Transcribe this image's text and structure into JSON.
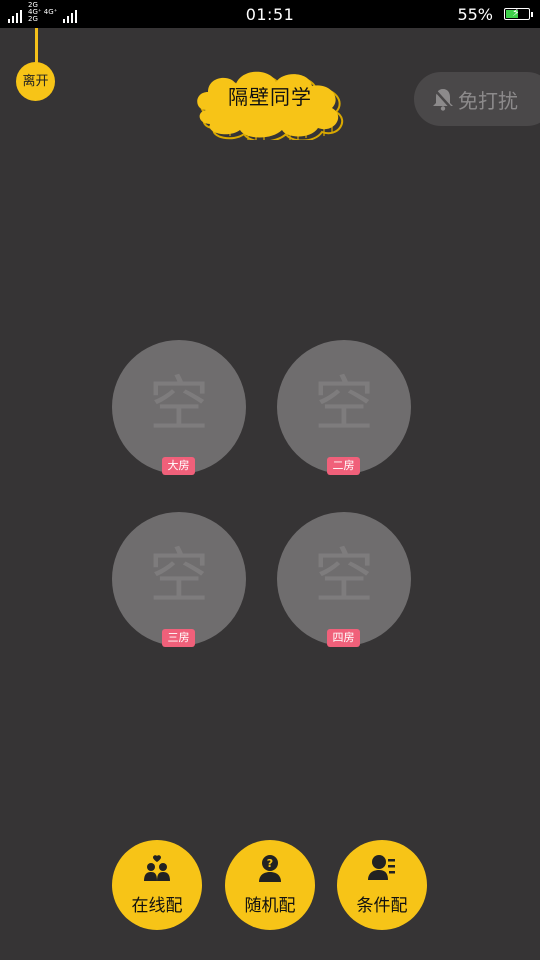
{
  "status_bar": {
    "net_top": "2G",
    "net_mid": "4G⁺ 4G⁺",
    "net_bottom": "2G",
    "time": "01:51",
    "battery_percent": "55%",
    "battery_level": 0.55
  },
  "leave_button": {
    "label": "离开"
  },
  "title": "隔壁同学",
  "dnd_button": {
    "label": "免打扰",
    "icon": "bell-muted-icon"
  },
  "rooms": [
    {
      "glyph": "空",
      "tag": "大房"
    },
    {
      "glyph": "空",
      "tag": "二房"
    },
    {
      "glyph": "空",
      "tag": "三房"
    },
    {
      "glyph": "空",
      "tag": "四房"
    }
  ],
  "match_buttons": [
    {
      "label": "在线配",
      "icon": "couple-heart-icon"
    },
    {
      "label": "随机配",
      "icon": "question-person-icon"
    },
    {
      "label": "条件配",
      "icon": "person-list-icon"
    }
  ],
  "colors": {
    "background": "#363435",
    "accent_yellow": "#f7c417",
    "room_circle": "#6f6d6e",
    "room_tag": "#f0607a"
  }
}
